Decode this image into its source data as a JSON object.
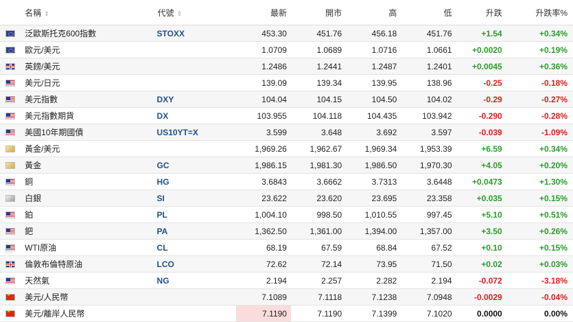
{
  "headers": {
    "name": "名稱",
    "code": "代號",
    "last": "最新",
    "open": "開市",
    "high": "高",
    "low": "低",
    "change": "升跌",
    "pct": "升跌率%"
  },
  "sort_icon": "⇕",
  "rows": [
    {
      "flag": "eu",
      "name": "泛歐斯托克600指數",
      "code": "STOXX",
      "last": "453.30",
      "open": "451.76",
      "high": "456.18",
      "low": "451.76",
      "change": "+1.54",
      "pct": "+0.34%",
      "dir": "up"
    },
    {
      "flag": "eu",
      "name": "歐元/美元",
      "code": "",
      "last": "1.0709",
      "open": "1.0689",
      "high": "1.0716",
      "low": "1.0661",
      "change": "+0.0020",
      "pct": "+0.19%",
      "dir": "up"
    },
    {
      "flag": "gb",
      "name": "英鎊/美元",
      "code": "",
      "last": "1.2486",
      "open": "1.2441",
      "high": "1.2487",
      "low": "1.2401",
      "change": "+0.0045",
      "pct": "+0.36%",
      "dir": "up"
    },
    {
      "flag": "us",
      "name": "美元/日元",
      "code": "",
      "last": "139.09",
      "open": "139.34",
      "high": "139.95",
      "low": "138.96",
      "change": "-0.25",
      "pct": "-0.18%",
      "dir": "down"
    },
    {
      "flag": "us",
      "name": "美元指數",
      "code": "DXY",
      "last": "104.04",
      "open": "104.15",
      "high": "104.50",
      "low": "104.02",
      "change": "-0.29",
      "pct": "-0.27%",
      "dir": "down"
    },
    {
      "flag": "us",
      "name": "美元指數期貨",
      "code": "DX",
      "last": "103.955",
      "open": "104.118",
      "high": "104.435",
      "low": "103.942",
      "change": "-0.290",
      "pct": "-0.28%",
      "dir": "down"
    },
    {
      "flag": "us",
      "name": "美國10年期國債",
      "code": "US10YT=X",
      "last": "3.599",
      "open": "3.648",
      "high": "3.692",
      "low": "3.597",
      "change": "-0.039",
      "pct": "-1.09%",
      "dir": "down"
    },
    {
      "flag": "gold",
      "name": "黃金/美元",
      "code": "",
      "last": "1,969.26",
      "open": "1,962.67",
      "high": "1,969.34",
      "low": "1,953.39",
      "change": "+6.59",
      "pct": "+0.34%",
      "dir": "up"
    },
    {
      "flag": "gold",
      "name": "黃金",
      "code": "GC",
      "last": "1,986.15",
      "open": "1,981.30",
      "high": "1,986.50",
      "low": "1,970.30",
      "change": "+4.05",
      "pct": "+0.20%",
      "dir": "up"
    },
    {
      "flag": "us",
      "name": "銅",
      "code": "HG",
      "last": "3.6843",
      "open": "3.6662",
      "high": "3.7313",
      "low": "3.6448",
      "change": "+0.0473",
      "pct": "+1.30%",
      "dir": "up"
    },
    {
      "flag": "silver",
      "name": "白銀",
      "code": "SI",
      "last": "23.622",
      "open": "23.620",
      "high": "23.695",
      "low": "23.358",
      "change": "+0.035",
      "pct": "+0.15%",
      "dir": "up"
    },
    {
      "flag": "us",
      "name": "鉑",
      "code": "PL",
      "last": "1,004.10",
      "open": "998.50",
      "high": "1,010.55",
      "low": "997.45",
      "change": "+5.10",
      "pct": "+0.51%",
      "dir": "up"
    },
    {
      "flag": "us",
      "name": "鈀",
      "code": "PA",
      "last": "1,362.50",
      "open": "1,361.00",
      "high": "1,394.00",
      "low": "1,357.00",
      "change": "+3.50",
      "pct": "+0.26%",
      "dir": "up"
    },
    {
      "flag": "us",
      "name": "WTI原油",
      "code": "CL",
      "last": "68.19",
      "open": "67.59",
      "high": "68.84",
      "low": "67.52",
      "change": "+0.10",
      "pct": "+0.15%",
      "dir": "up"
    },
    {
      "flag": "gb",
      "name": "倫敦布倫特原油",
      "code": "LCO",
      "last": "72.62",
      "open": "72.14",
      "high": "73.95",
      "low": "71.50",
      "change": "+0.02",
      "pct": "+0.03%",
      "dir": "up"
    },
    {
      "flag": "us",
      "name": "天然氣",
      "code": "NG",
      "last": "2.194",
      "open": "2.257",
      "high": "2.282",
      "low": "2.194",
      "change": "-0.072",
      "pct": "-3.18%",
      "dir": "down"
    },
    {
      "flag": "cn",
      "name": "美元/人民幣",
      "code": "",
      "last": "7.1089",
      "open": "7.1118",
      "high": "7.1238",
      "low": "7.0948",
      "change": "-0.0029",
      "pct": "-0.04%",
      "dir": "down"
    },
    {
      "flag": "cn",
      "name": "美元/離岸人民幣",
      "code": "",
      "last": "7.1190",
      "open": "7.1190",
      "high": "7.1399",
      "low": "7.1020",
      "change": "0.0000",
      "pct": "0.00%",
      "dir": "flat",
      "highlight_last": true
    }
  ],
  "colors": {
    "up": "#2a9d2a",
    "down": "#e01b1b",
    "code": "#1f4e8c",
    "highlight": "#fbdcdc"
  }
}
